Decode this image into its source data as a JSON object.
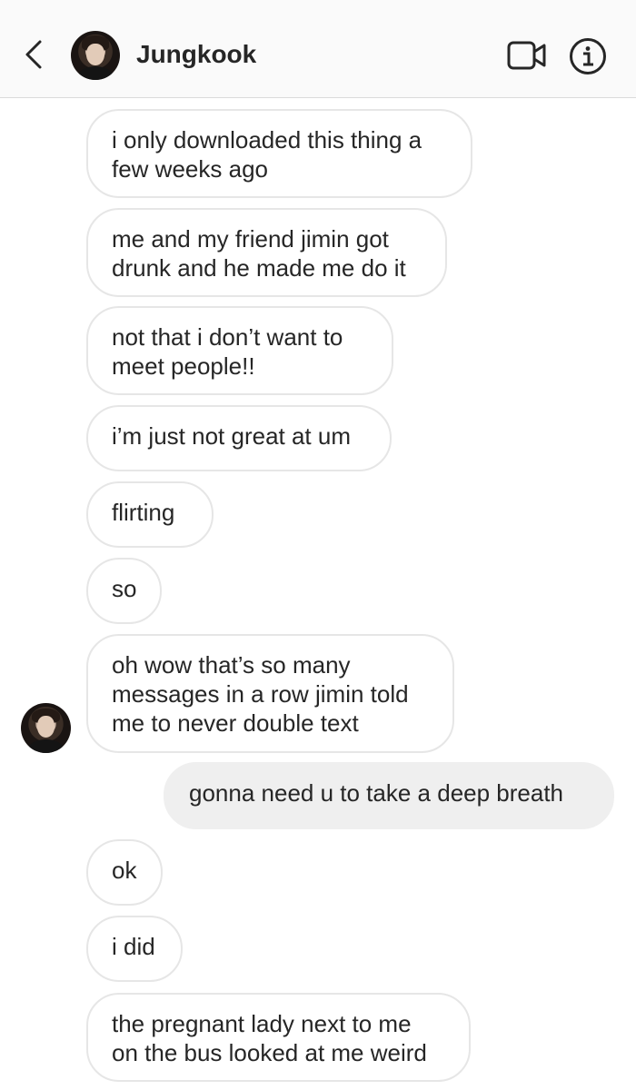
{
  "header": {
    "contact_name": "Jungkook",
    "icons": [
      "back-chevron-icon",
      "video-call-icon",
      "info-icon"
    ]
  },
  "messages": [
    {
      "sender": "them",
      "text": "i only downloaded this thing a\nfew weeks ago"
    },
    {
      "sender": "them",
      "text": "me and my friend jimin got\ndrunk and he made me do it"
    },
    {
      "sender": "them",
      "text": "not that i don’t want to\nmeet people!!"
    },
    {
      "sender": "them",
      "text": "i’m just not great at um"
    },
    {
      "sender": "them",
      "text": "flirting"
    },
    {
      "sender": "them",
      "text": "so"
    },
    {
      "sender": "them",
      "text": "oh wow that’s so many\nmessages in a row jimin told\nme to never double text"
    },
    {
      "sender": "me",
      "text": "gonna need u to take a deep breath"
    },
    {
      "sender": "them",
      "text": "ok"
    },
    {
      "sender": "them",
      "text": "i did"
    },
    {
      "sender": "them",
      "text": "the pregnant lady next to me\non the bus looked at me weird"
    }
  ],
  "colors": {
    "header_bg": "#fafafa",
    "bubble_border": "#e6e6e6",
    "outgoing_bg": "#efefef",
    "text": "#262626"
  }
}
